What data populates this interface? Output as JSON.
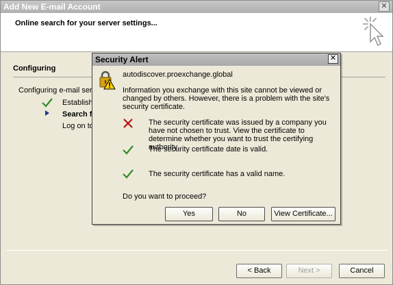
{
  "wizard": {
    "title": "Add New E-mail Account",
    "header_title": "Online search for your server settings...",
    "section_title": "Configuring",
    "config_text": "Configuring e-mail server",
    "steps": [
      {
        "label": "Establish n",
        "status": "done"
      },
      {
        "label": "Search fo",
        "status": "current"
      },
      {
        "label": "Log on to",
        "status": "pending"
      }
    ],
    "buttons": {
      "back": "< Back",
      "next": "Next >",
      "cancel": "Cancel"
    }
  },
  "dialog": {
    "title": "Security Alert",
    "host": "autodiscover.proexchange.global",
    "info": "Information you exchange with this site cannot be viewed or changed by others. However, there is a problem with the site's security certificate.",
    "items": [
      {
        "icon": "x-icon",
        "text": "The security certificate was issued by a company you have not chosen to trust. View the certificate to determine whether you want to trust the certifying authority."
      },
      {
        "icon": "check-icon",
        "text": "The security certificate date is valid."
      },
      {
        "icon": "check-icon",
        "text": "The security certificate has a valid name."
      }
    ],
    "question": "Do you want to proceed?",
    "buttons": {
      "yes": "Yes",
      "no": "No",
      "view": "View Certificate..."
    }
  },
  "colors": {
    "check": "#2e8b2e",
    "x": "#b01010",
    "arrow": "#1b3a8c"
  }
}
